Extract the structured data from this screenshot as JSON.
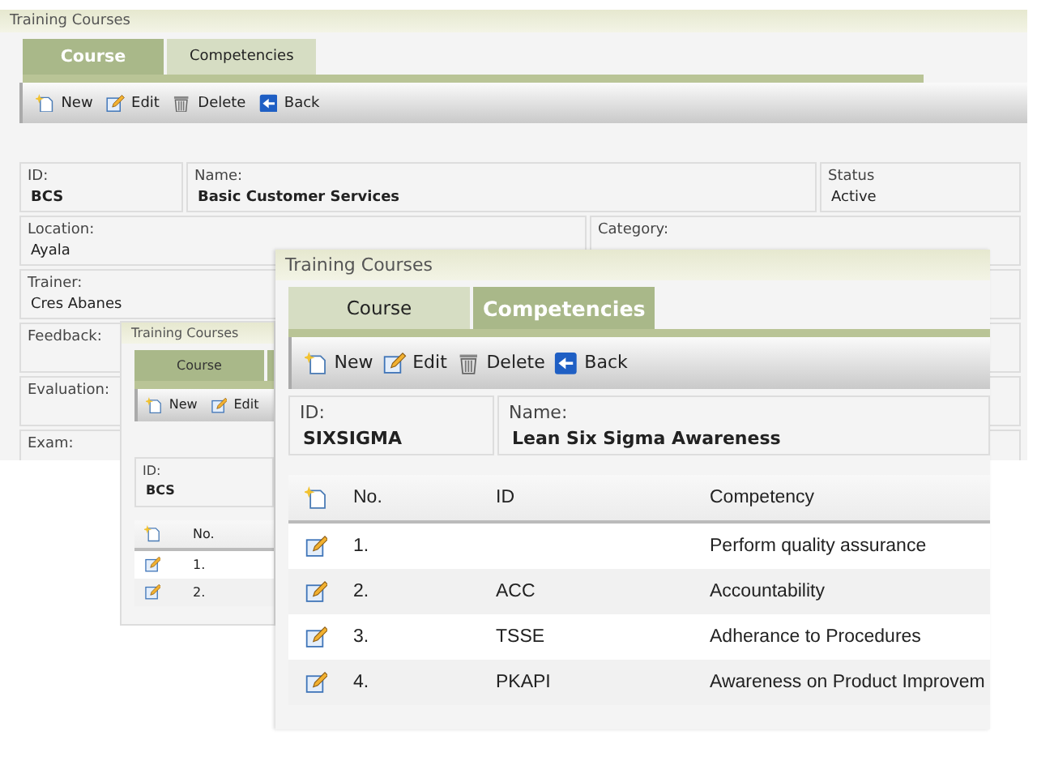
{
  "windows": [
    {
      "title": "Training Courses",
      "tabs": [
        {
          "label": "Course",
          "selected": true
        },
        {
          "label": "Competencies",
          "selected": false
        }
      ],
      "toolbar": [
        {
          "kind": "new",
          "label": "New"
        },
        {
          "kind": "edit",
          "label": "Edit"
        },
        {
          "kind": "delete",
          "label": "Delete"
        },
        {
          "kind": "back",
          "label": "Back"
        }
      ],
      "fields": [
        [
          {
            "label": "ID:",
            "value": "BCS"
          },
          {
            "label": "Name:",
            "value": "Basic Customer Services"
          },
          {
            "label": "Status",
            "value": "Active"
          }
        ],
        [
          {
            "label": "Location:",
            "value": "Ayala"
          },
          {
            "label": "Category:"
          }
        ],
        [
          {
            "label": "Trainer:",
            "value": "Cres Abanes"
          }
        ],
        [
          {
            "label": "Feedback:"
          }
        ],
        [
          {
            "label": "Evaluation:"
          }
        ],
        [
          {
            "label": "Exam:"
          }
        ]
      ]
    },
    {
      "title": "Training Courses",
      "tabs": [
        {
          "label": "Course",
          "selected": true
        }
      ],
      "toolbar": [
        {
          "kind": "new",
          "label": "New"
        },
        {
          "kind": "edit",
          "label": "Edit"
        }
      ],
      "fields": [
        [
          {
            "label": "ID:",
            "value": "BCS"
          }
        ]
      ],
      "table": {
        "columns": [
          "No."
        ],
        "rows": [
          [
            "1."
          ],
          [
            "2."
          ]
        ]
      }
    },
    {
      "title": "Training Courses",
      "tabs": [
        {
          "label": "Course",
          "selected": false
        },
        {
          "label": "Competencies",
          "selected": true
        }
      ],
      "toolbar": [
        {
          "kind": "new",
          "label": "New"
        },
        {
          "kind": "edit",
          "label": "Edit"
        },
        {
          "kind": "delete",
          "label": "Delete"
        },
        {
          "kind": "back",
          "label": "Back"
        }
      ],
      "fields": [
        [
          {
            "label": "ID:",
            "value": "SIXSIGMA"
          },
          {
            "label": "Name:",
            "value": "Lean Six Sigma Awareness"
          }
        ]
      ],
      "table": {
        "columns": [
          "No.",
          "ID",
          "Competency"
        ],
        "rows": [
          [
            "1.",
            "",
            "Perform quality assurance"
          ],
          [
            "2.",
            "ACC",
            "Accountability"
          ],
          [
            "3.",
            "TSSE",
            "Adherance to Procedures"
          ],
          [
            "4.",
            "PKAPI",
            "Awareness on Product Improvem"
          ]
        ]
      }
    }
  ]
}
